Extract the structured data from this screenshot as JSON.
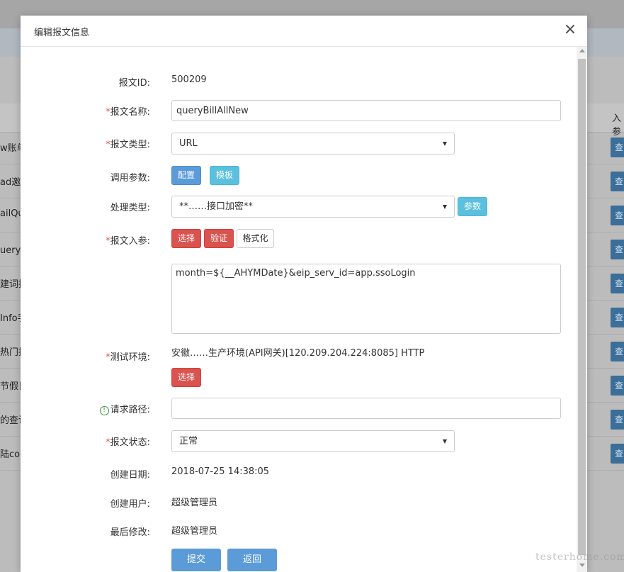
{
  "background": {
    "column_header": "入参",
    "rows": [
      {
        "label": "w账单",
        "action": "查看"
      },
      {
        "label": "ad邀请",
        "action": "查看"
      },
      {
        "label": "ailQue",
        "action": "查看"
      },
      {
        "label": "uery充",
        "action": "查看"
      },
      {
        "label": "建词搜",
        "action": "查看"
      },
      {
        "label": "Info手",
        "action": "查看"
      },
      {
        "label": "热门搜",
        "action": "查看"
      },
      {
        "label": "节假日",
        "action": "查看"
      },
      {
        "label": "的查询",
        "action": "查看"
      },
      {
        "label": "陆coo",
        "action": "查看"
      }
    ]
  },
  "modal": {
    "title": "编辑报文信息",
    "close_label": "×"
  },
  "form": {
    "id": {
      "label": "报文ID:",
      "value": "500209"
    },
    "name": {
      "label": "报文名称:",
      "value": "queryBillAllNew"
    },
    "type": {
      "label": "报文类型:",
      "value": "URL"
    },
    "params": {
      "label": "调用参数:",
      "config_button": "配置",
      "template_button": "模板"
    },
    "process": {
      "label": "处理类型:",
      "value": "**……接口加密**",
      "params_button": "参数"
    },
    "input": {
      "label": "报文入参:",
      "select_button": "选择",
      "verify_button": "验证",
      "format_button": "格式化",
      "value": "month=${__AHYMDate}&eip_serv_id=app.ssoLogin"
    },
    "env": {
      "label": "测试环境:",
      "value": "安徽……生产环境(API网关)[120.209.204.224:8085] HTTP",
      "select_button": "选择"
    },
    "path": {
      "label": "请求路径:",
      "value": ""
    },
    "status": {
      "label": "报文状态:",
      "value": "正常"
    },
    "created_date": {
      "label": "创建日期:",
      "value": "2018-07-25 14:38:05"
    },
    "created_user": {
      "label": "创建用户:",
      "value": "超级管理员"
    },
    "modified": {
      "label": "最后修改:",
      "value": "超级管理员"
    }
  },
  "actions": {
    "submit": "提交",
    "back": "返回"
  },
  "watermark": "testerhome.com"
}
